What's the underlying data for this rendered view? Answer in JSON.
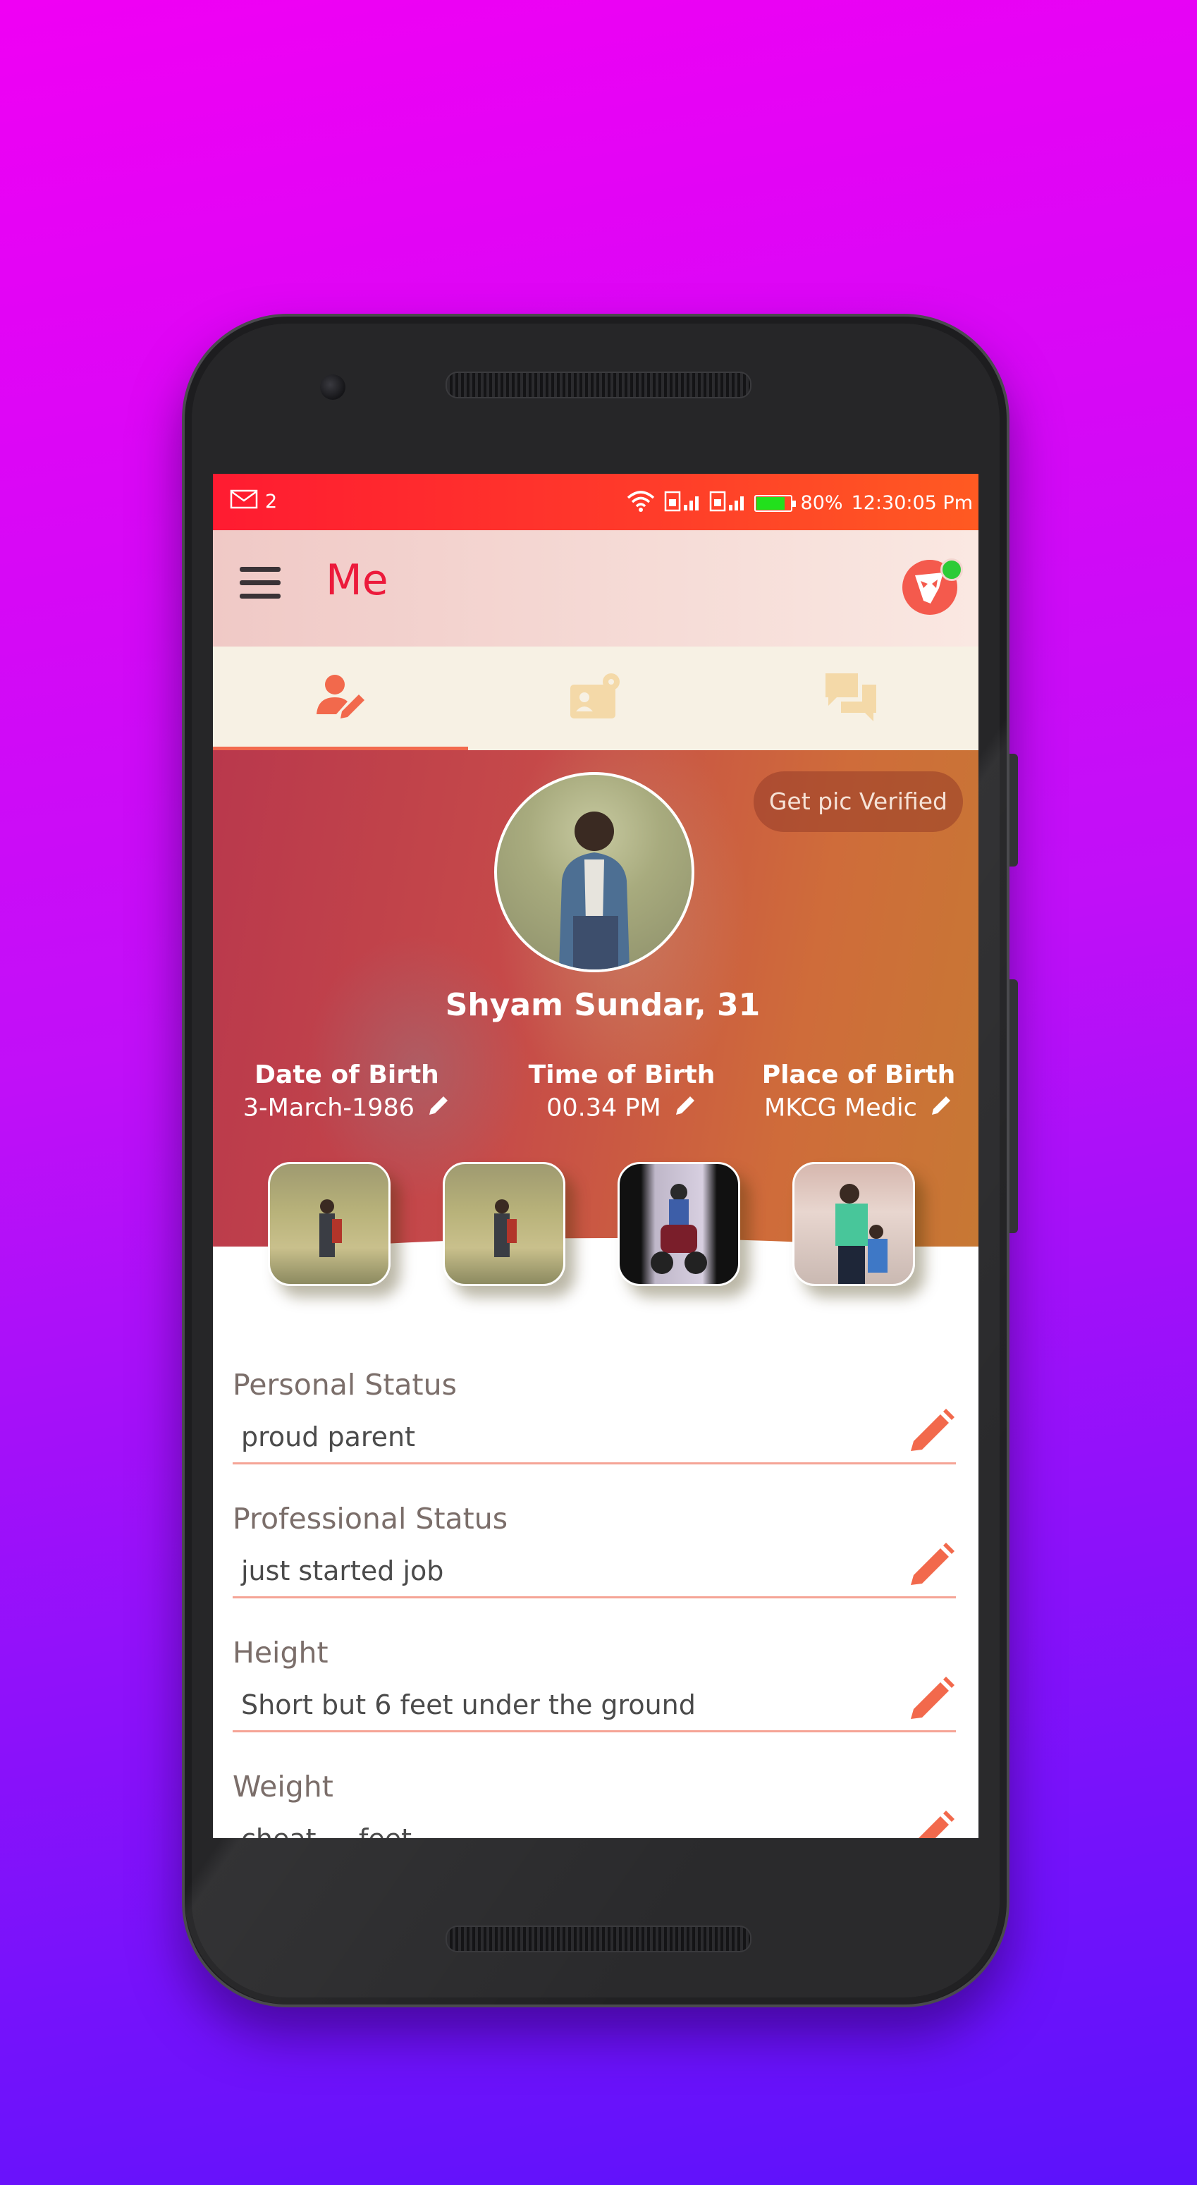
{
  "status_bar": {
    "message_count": "2",
    "battery_percent": "80%",
    "time": "12:30:05 Pm",
    "battery_level": 0.8
  },
  "app_bar": {
    "title": "Me"
  },
  "tabs": [
    {
      "icon": "person-edit-icon",
      "active": true
    },
    {
      "icon": "profile-settings-icon",
      "active": false
    },
    {
      "icon": "chat-icon",
      "active": false
    }
  ],
  "profile": {
    "verify_button": "Get pic Verified",
    "name_age": "Shyam Sundar, 31",
    "birth": [
      {
        "label": "Date of Birth",
        "value": "3-March-1986"
      },
      {
        "label": "Time of Birth",
        "value": "00.34 PM"
      },
      {
        "label": "Place of Birth",
        "value": "MKCG Medic"
      }
    ]
  },
  "fields": [
    {
      "label": "Personal Status",
      "value": "proud parent"
    },
    {
      "label": "Professional Status",
      "value": "just started job"
    },
    {
      "label": "Height",
      "value": "Short but 6 feet under the ground"
    },
    {
      "label": "Weight",
      "value": "cheat ... feet"
    }
  ],
  "colors": {
    "accent": "#ec1a3b",
    "status_bar": "#ff3a2a",
    "edit_icon": "#f2694c",
    "underline": "#f5a496"
  }
}
